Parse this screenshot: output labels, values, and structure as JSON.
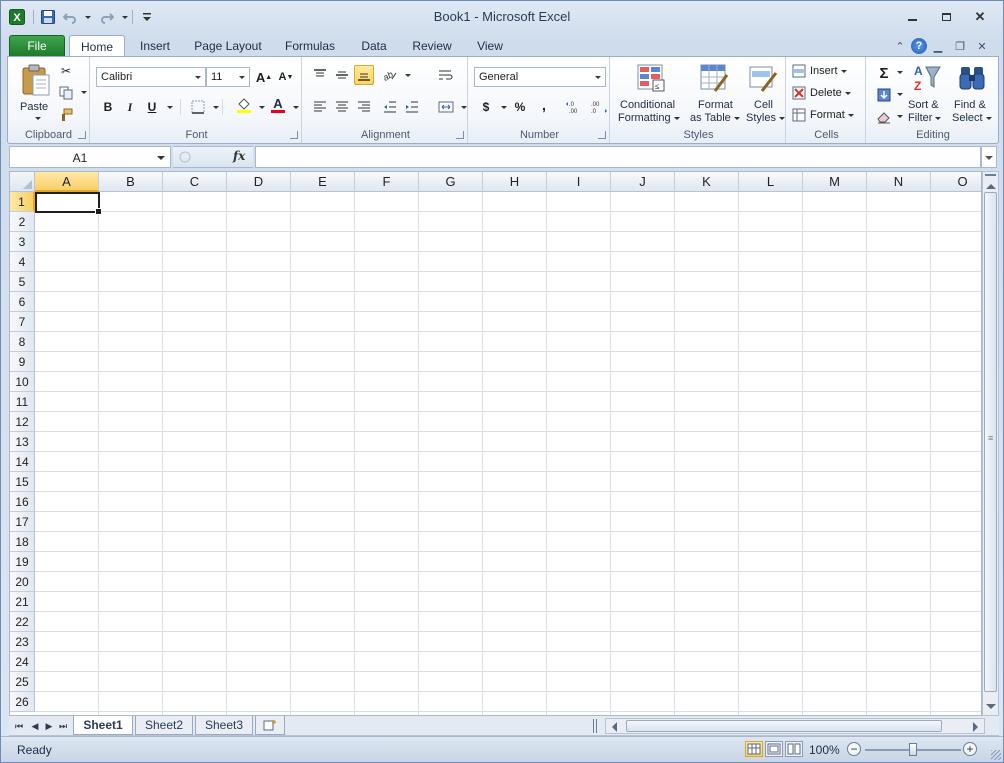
{
  "window": {
    "title": "Book1  -  Microsoft Excel",
    "app_icon": "X"
  },
  "quick_access": [
    {
      "icon": "save-icon"
    },
    {
      "icon": "undo-icon"
    },
    {
      "icon": "redo-icon"
    },
    {
      "icon": "customize-icon"
    }
  ],
  "ribbon_tabs": {
    "file": "File",
    "home": "Home",
    "insert": "Insert",
    "page_layout": "Page Layout",
    "formulas": "Formulas",
    "data": "Data",
    "review": "Review",
    "view": "View"
  },
  "clipboard": {
    "label": "Clipboard",
    "paste": "Paste"
  },
  "font": {
    "label": "Font",
    "name": "Calibri",
    "size": "11",
    "bold": "B",
    "italic": "I",
    "underline": "U",
    "grow": "A",
    "shrink": "A",
    "color": "A"
  },
  "alignment": {
    "label": "Alignment"
  },
  "number": {
    "label": "Number",
    "format": "General",
    "currency": "$",
    "percent": "%",
    "comma": ",",
    "inc_decimal": "←.0 .00",
    "dec_decimal": ".00 →.0"
  },
  "styles": {
    "label": "Styles",
    "conditional_l1": "Conditional",
    "conditional_l2": "Formatting",
    "format_table_l1": "Format",
    "format_table_l2": "as Table",
    "cell_styles_l1": "Cell",
    "cell_styles_l2": "Styles"
  },
  "cells": {
    "label": "Cells",
    "insert": "Insert",
    "delete": "Delete",
    "format": "Format"
  },
  "editing": {
    "label": "Editing",
    "sum": "Σ",
    "sort_l1": "Sort &",
    "sort_l2": "Filter",
    "find_l1": "Find &",
    "find_l2": "Select"
  },
  "formula_bar": {
    "name_box": "A1",
    "fx": "fx",
    "formula": ""
  },
  "grid": {
    "columns": [
      "A",
      "B",
      "C",
      "D",
      "E",
      "F",
      "G",
      "H",
      "I",
      "J",
      "K",
      "L",
      "M",
      "N",
      "O"
    ],
    "rows": [
      "1",
      "2",
      "3",
      "4",
      "5",
      "6",
      "7",
      "8",
      "9",
      "10",
      "11",
      "12",
      "13",
      "14",
      "15",
      "16",
      "17",
      "18",
      "19",
      "20",
      "21",
      "22",
      "23",
      "24",
      "25",
      "26"
    ],
    "active_cell": "A1"
  },
  "sheets": [
    "Sheet1",
    "Sheet2",
    "Sheet3"
  ],
  "active_sheet": "Sheet1",
  "status": {
    "text": "Ready",
    "zoom": "100%",
    "zoom_fraction": 0.5
  },
  "colors": {
    "file_tab": "#2a8c39",
    "selection_header": "#f8cf66",
    "grid_line": "#d9dfe7",
    "title_bar": "#dfe9f5"
  }
}
